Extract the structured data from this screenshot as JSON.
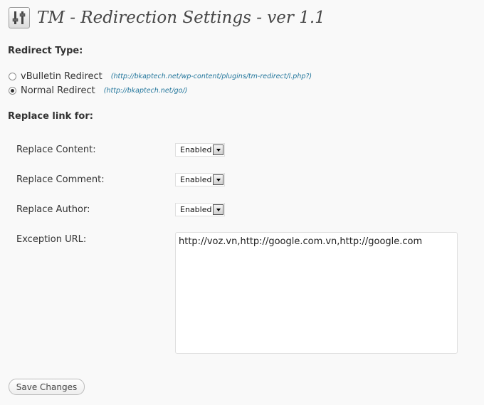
{
  "page": {
    "title": "TM - Redirection Settings - ver 1.1",
    "icon": "settings-sliders-icon"
  },
  "redirect_type": {
    "heading": "Redirect Type:",
    "options": [
      {
        "label": "vBulletin Redirect",
        "hint": "(http://bkaptech.net/wp-content/plugins/tm-redirect/l.php?)",
        "selected": false
      },
      {
        "label": "Normal Redirect",
        "hint": "(http://bkaptech.net/go/)",
        "selected": true
      }
    ]
  },
  "replace_link": {
    "heading": "Replace link for:",
    "fields": [
      {
        "label": "Replace Content:",
        "value": "Enabled"
      },
      {
        "label": "Replace Comment:",
        "value": "Enabled"
      },
      {
        "label": "Replace Author:",
        "value": "Enabled"
      }
    ],
    "exception_label": "Exception URL:",
    "exception_value": "http://voz.vn,http://google.com.vn,http://google.com"
  },
  "actions": {
    "save_label": "Save Changes"
  },
  "colors": {
    "background": "#f9f9f9",
    "link_hint": "#21759b",
    "title": "#464646"
  }
}
